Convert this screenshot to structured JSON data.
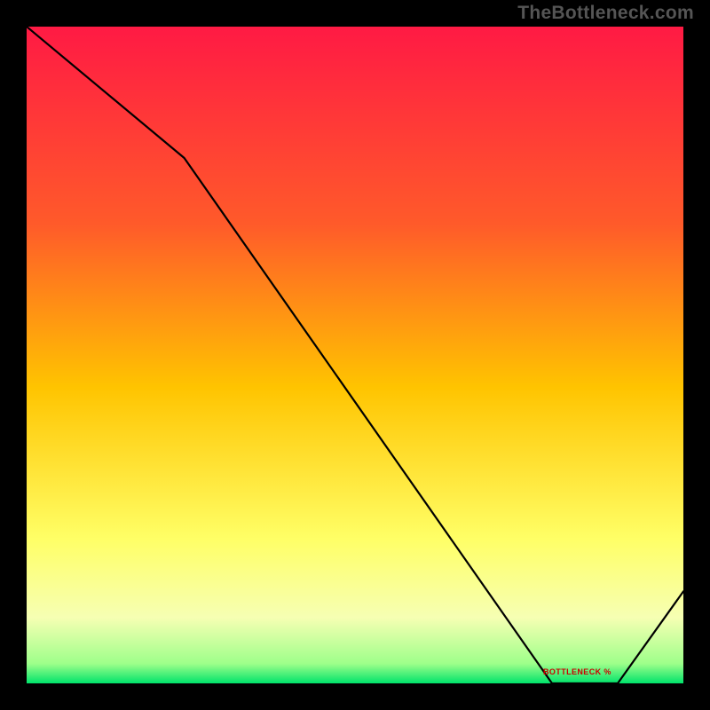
{
  "watermark": "TheBottleneck.com",
  "line_label": "BOTTLENECK %",
  "chart_data": {
    "type": "line",
    "title": "",
    "xlabel": "",
    "ylabel": "",
    "series": [
      {
        "name": "bottleneck-percent",
        "x": [
          0,
          24,
          80,
          90,
          100
        ],
        "values": [
          100,
          80,
          0,
          0,
          14
        ]
      }
    ],
    "xlim": [
      0,
      100
    ],
    "ylim": [
      0,
      100
    ],
    "optimal_band": {
      "x_start": 80,
      "x_end": 90
    },
    "background": {
      "type": "vertical-gradient",
      "stops": [
        {
          "pos": 0.0,
          "color": "#ff1a44"
        },
        {
          "pos": 0.3,
          "color": "#ff5a2a"
        },
        {
          "pos": 0.55,
          "color": "#ffc400"
        },
        {
          "pos": 0.78,
          "color": "#ffff66"
        },
        {
          "pos": 0.9,
          "color": "#f6ffb3"
        },
        {
          "pos": 0.97,
          "color": "#9eff8a"
        },
        {
          "pos": 1.0,
          "color": "#00e36b"
        }
      ]
    }
  }
}
